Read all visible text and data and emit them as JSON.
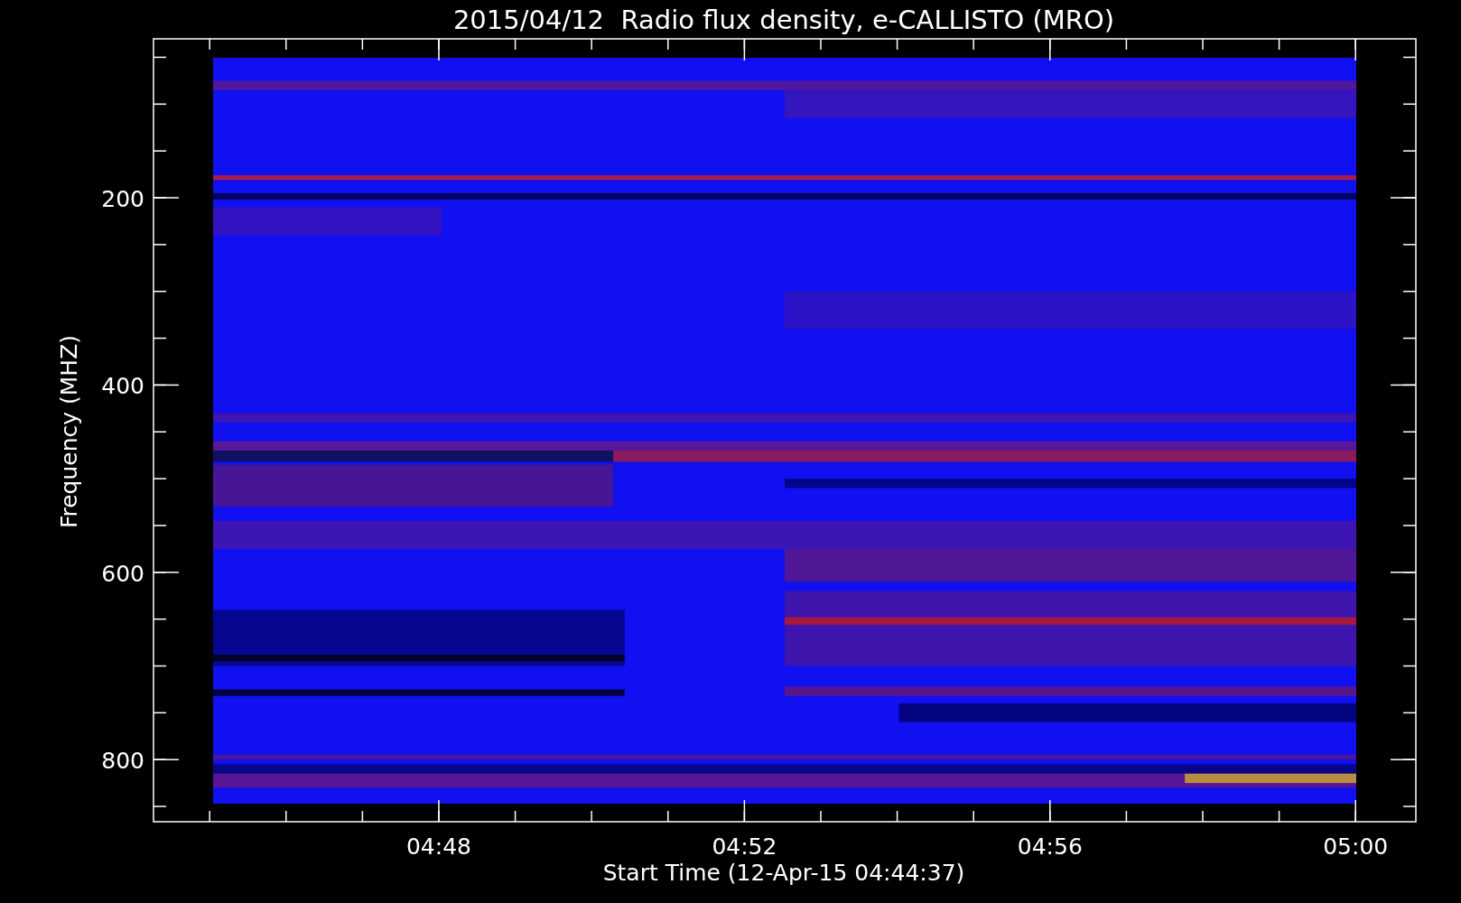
{
  "title": "2015/04/12  Radio flux density, e-CALLISTO (MRO)",
  "y_axis": {
    "label": "Frequency (MHZ)",
    "ticks": [
      "200",
      "400",
      "600",
      "800"
    ]
  },
  "x_axis": {
    "label": "Start Time (12-Apr-15 04:44:37)",
    "ticks": [
      "04:48",
      "04:52",
      "04:56",
      "05:00"
    ]
  }
}
